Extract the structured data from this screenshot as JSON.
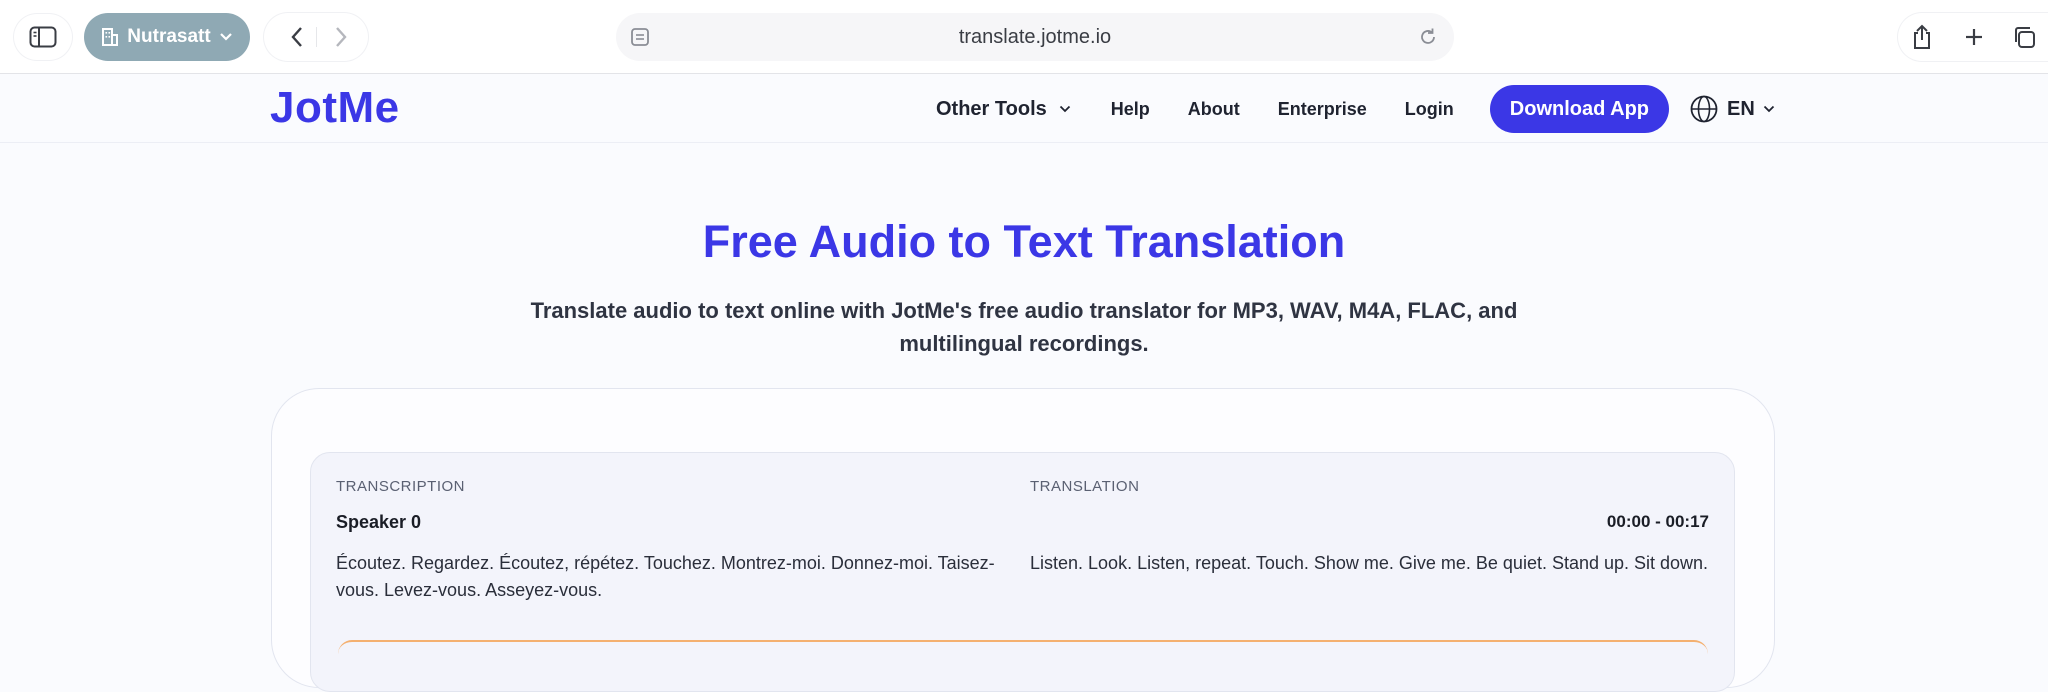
{
  "browser": {
    "profile_label": "Nutrasatt",
    "url": "translate.jotme.io"
  },
  "header": {
    "logo": "JotMe",
    "nav": {
      "other_tools": "Other Tools",
      "help": "Help",
      "about": "About",
      "enterprise": "Enterprise",
      "login": "Login"
    },
    "download_label": "Download App",
    "language": "EN"
  },
  "hero": {
    "title": "Free Audio to Text Translation",
    "subtitle": "Translate audio to text online with JotMe's free audio translator for MP3, WAV, M4A, FLAC, and multilingual recordings."
  },
  "result": {
    "transcription_label": "TRANSCRIPTION",
    "translation_label": "TRANSLATION",
    "speaker": "Speaker 0",
    "timestamp": "00:00 - 00:17",
    "transcription_text": "Écoutez. Regardez. Écoutez, répétez. Touchez. Montrez-moi. Donnez-moi. Taisez-vous. Levez-vous. Asseyez-vous.",
    "translation_text": "Listen. Look. Listen, repeat. Touch. Show me. Give me. Be quiet. Stand up. Sit down."
  },
  "colors": {
    "brand": "#3b37e6",
    "profile_pill": "#8fa9b4",
    "accent_orange": "#f4b070"
  },
  "icons": [
    "sidebar-icon",
    "building-icon",
    "chevron-down-icon",
    "back-arrow-icon",
    "forward-arrow-icon",
    "reader-icon",
    "reload-icon",
    "share-icon",
    "plus-icon",
    "tabs-icon",
    "globe-icon"
  ]
}
